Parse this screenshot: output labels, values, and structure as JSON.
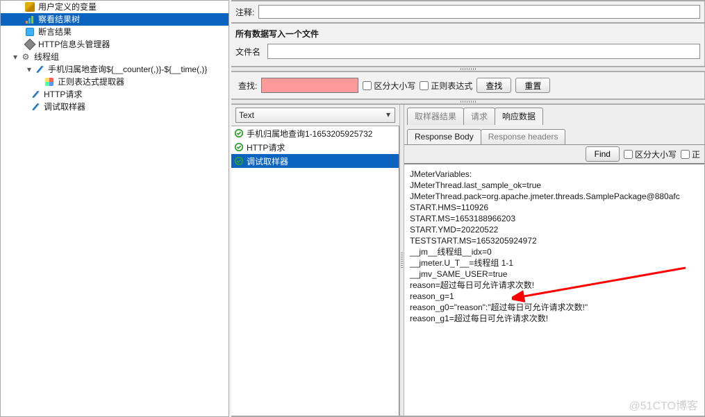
{
  "tree": {
    "nodes": [
      {
        "indent": 32,
        "icon": "vars",
        "label": "用户定义的变量"
      },
      {
        "indent": 32,
        "icon": "results",
        "label": "察看结果树",
        "selected": true
      },
      {
        "indent": 32,
        "icon": "assert",
        "label": "断言结果"
      },
      {
        "indent": 32,
        "icon": "header",
        "label": "HTTP信息头管理器"
      },
      {
        "indent": 16,
        "icon": "gear",
        "label": "线程组",
        "toggle": "▾"
      },
      {
        "indent": 36,
        "icon": "pipette",
        "label": "手机归属地查询${__counter(,)}-${__time(,)}",
        "toggle": "▾"
      },
      {
        "indent": 60,
        "icon": "regex",
        "label": "正则表达式提取器"
      },
      {
        "indent": 40,
        "icon": "pipette",
        "label": "HTTP请求"
      },
      {
        "indent": 40,
        "icon": "pipette",
        "label": "调试取样器"
      }
    ]
  },
  "comment": {
    "label": "注释:"
  },
  "file_panel": {
    "title": "所有数据写入一个文件",
    "filename_label": "文件名"
  },
  "search": {
    "label": "查找:",
    "case_label": "区分大小写",
    "regex_label": "正则表达式",
    "search_btn": "查找",
    "reset_btn": "重置"
  },
  "results": {
    "combo": "Text",
    "samples": [
      {
        "label": "手机归属地查询1-1653205925732"
      },
      {
        "label": "HTTP请求"
      },
      {
        "label": "调试取样器",
        "selected": true
      }
    ],
    "tabs_top": {
      "sampler": "取样器结果",
      "request": "请求",
      "response": "响应数据"
    },
    "tabs_sub": {
      "body": "Response Body",
      "headers": "Response headers"
    },
    "find": {
      "btn": "Find",
      "case": "区分大小写",
      "regex": "正"
    },
    "body_lines": [
      "JMeterVariables:",
      "JMeterThread.last_sample_ok=true",
      "JMeterThread.pack=org.apache.jmeter.threads.SamplePackage@880afc",
      "START.HMS=110926",
      "START.MS=1653188966203",
      "START.YMD=20220522",
      "TESTSTART.MS=1653205924972",
      "__jm__线程组__idx=0",
      "__jmeter.U_T__=线程组 1-1",
      "__jmv_SAME_USER=true",
      "reason=超过每日可允许请求次数!",
      "reason_g=1",
      "reason_g0=\"reason\":\"超过每日可允许请求次数!\"",
      "reason_g1=超过每日可允许请求次数!"
    ]
  },
  "watermark": "@51CTO博客"
}
